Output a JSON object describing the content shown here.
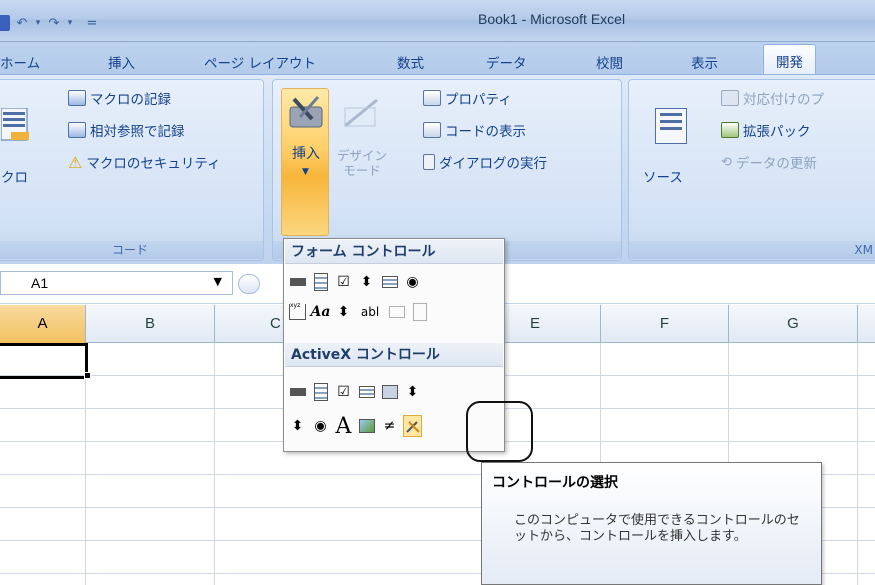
{
  "window": {
    "title": "Book1 - Microsoft Excel"
  },
  "qat": {
    "undo_icon": "undo-icon",
    "redo_icon": "redo-icon",
    "customize": "="
  },
  "tabs": [
    {
      "label": "ホーム"
    },
    {
      "label": "挿入"
    },
    {
      "label": "ページ レイアウト"
    },
    {
      "label": "数式"
    },
    {
      "label": "データ"
    },
    {
      "label": "校閲"
    },
    {
      "label": "表示"
    },
    {
      "label": "開発",
      "active": true
    }
  ],
  "ribbon": {
    "code_group": {
      "label": "コード",
      "macro_button": "クロ",
      "record_macro": "マクロの記録",
      "relative_ref": "相対参照で記録",
      "macro_security": "マクロのセキュリティ"
    },
    "controls_group": {
      "insert_button": "挿入",
      "design_mode_line1": "デザイン",
      "design_mode_line2": "モード",
      "properties": "プロパティ",
      "view_code": "コードの表示",
      "run_dialog": "ダイアログの実行"
    },
    "xml_group": {
      "label": "XM",
      "source_button": "ソース",
      "map_properties": "対応付けのプ",
      "expansion_packs": "拡張パック",
      "refresh_data": "データの更新"
    }
  },
  "formula_bar": {
    "name_box_value": "A1"
  },
  "columns": [
    "A",
    "B",
    "C",
    "E",
    "F",
    "G"
  ],
  "gallery": {
    "form_controls_header": "フォーム コントロール",
    "activex_controls_header": "ActiveX コントロール",
    "form_row1": [
      "button",
      "combo-box",
      "checkbox",
      "spin",
      "list-box",
      "option"
    ],
    "form_row2_text": [
      "Aa",
      "abl"
    ],
    "activex_row2_text": [
      "A"
    ]
  },
  "tooltip": {
    "title": "コントロールの選択",
    "body": "このコンピュータで使用できるコントロールのセットから、コントロールを挿入します。"
  }
}
